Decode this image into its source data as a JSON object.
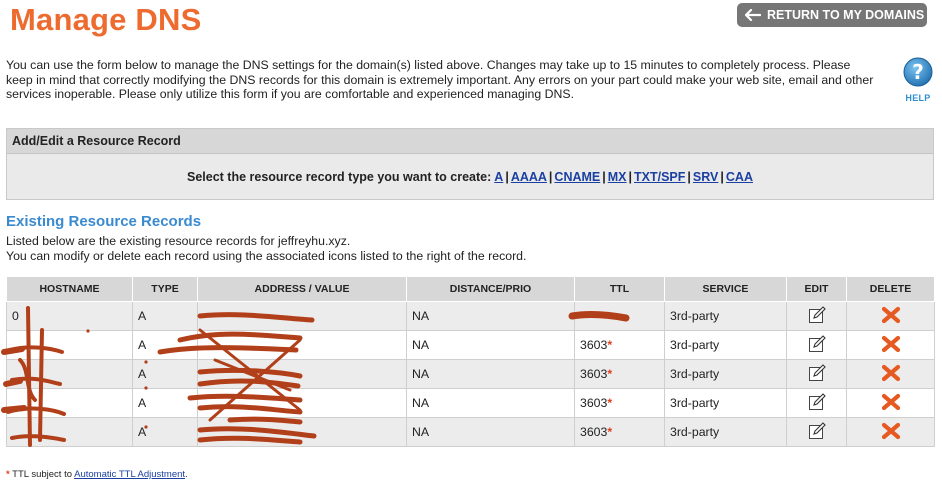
{
  "page": {
    "title": "Manage DNS",
    "return_label": "RETURN TO MY DOMAINS",
    "intro": "You can use the form below to manage the DNS settings for the domain(s) listed above. Changes may take up to 15 minutes to completely process. Please keep in mind that correctly modifying the DNS records for this domain is extremely important. Any errors on your part could make your web site, email and other services inoperable. Please only utilize this form if you are comfortable and experienced managing DNS.",
    "help_label": "HELP"
  },
  "add_record": {
    "heading": "Add/Edit a Resource Record",
    "prompt": "Select the resource record type you want to create:",
    "types": [
      "A",
      "AAAA",
      "CNAME",
      "MX",
      "TXT/SPF",
      "SRV",
      "CAA"
    ]
  },
  "existing": {
    "title": "Existing Resource Records",
    "desc_line1": "Listed below are the existing resource records for jeffreyhu.xyz.",
    "desc_line2": "You can modify or delete each record using the associated icons listed to the right of the record.",
    "columns": [
      "HOSTNAME",
      "TYPE",
      "ADDRESS / VALUE",
      "DISTANCE/PRIO",
      "TTL",
      "SERVICE",
      "EDIT",
      "DELETE"
    ],
    "rows": [
      {
        "hostname": "0",
        "type": "A",
        "address": "",
        "distance": "NA",
        "ttl": "",
        "ttl_star": "",
        "service": "3rd-party"
      },
      {
        "hostname": "",
        "type": "A",
        "address": "",
        "distance": "NA",
        "ttl": "3603",
        "ttl_star": "*",
        "service": "3rd-party"
      },
      {
        "hostname": "",
        "type": "A",
        "address": "",
        "distance": "NA",
        "ttl": "3603",
        "ttl_star": "*",
        "service": "3rd-party"
      },
      {
        "hostname": "",
        "type": "A",
        "address": "",
        "distance": "NA",
        "ttl": "3603",
        "ttl_star": "*",
        "service": "3rd-party"
      },
      {
        "hostname": "",
        "type": "A",
        "address": "",
        "distance": "NA",
        "ttl": "3603",
        "ttl_star": "*",
        "service": "3rd-party"
      }
    ]
  },
  "footnote": {
    "star": "*",
    "text": "TTL subject to",
    "link": "Automatic TTL Adjustment",
    "end": "."
  },
  "colors": {
    "title": "#ee6b2f",
    "section_title": "#3a8ad0",
    "link": "#1a3fa0",
    "delete_icon": "#e65a22",
    "redaction": "#b1401a"
  },
  "icons": {
    "return": "arrow-left-icon",
    "help": "question-mark-icon",
    "edit": "pencil-icon",
    "delete": "red-x-icon"
  }
}
